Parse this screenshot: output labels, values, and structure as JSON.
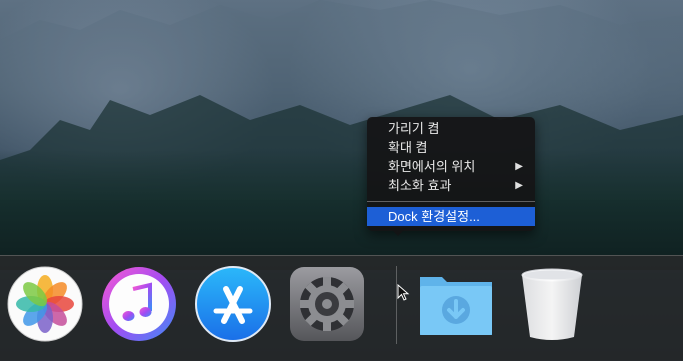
{
  "context_menu": {
    "items": [
      {
        "label": "가리기 켬",
        "submenu": false
      },
      {
        "label": "확대 켬",
        "submenu": false
      },
      {
        "label": "화면에서의 위치",
        "submenu": true
      },
      {
        "label": "최소화 효과",
        "submenu": true
      }
    ],
    "preferences_label": "Dock 환경설정...",
    "submenu_arrow": "▶"
  },
  "dock": {
    "apps": [
      {
        "name": "photos-app-icon"
      },
      {
        "name": "itunes-app-icon"
      },
      {
        "name": "app-store-app-icon"
      },
      {
        "name": "system-preferences-app-icon"
      },
      {
        "name": "downloads-folder-icon"
      },
      {
        "name": "trash-icon"
      }
    ]
  },
  "colors": {
    "menu_highlight": "#1d5fd6",
    "dock_background": "#2a2a2c",
    "folder_blue": "#6cc3f5"
  }
}
